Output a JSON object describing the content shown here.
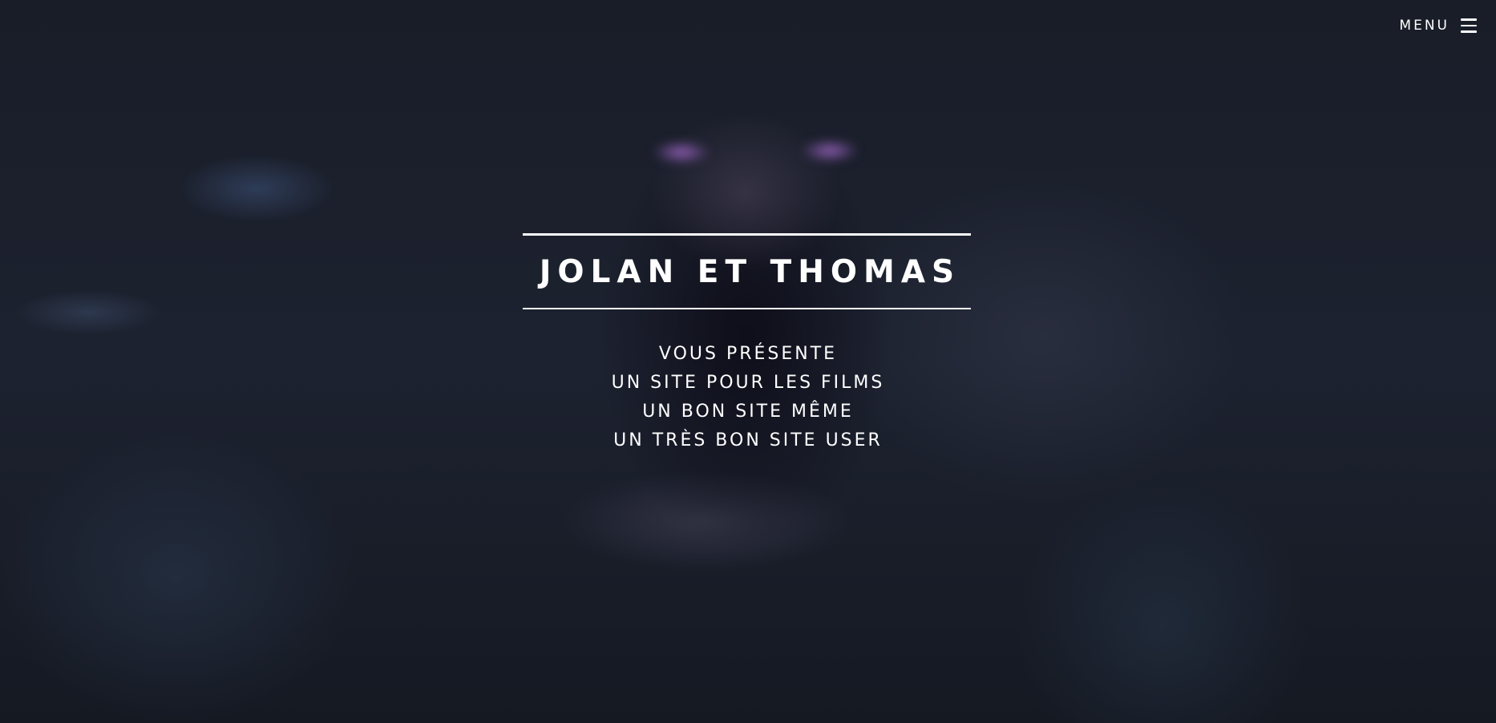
{
  "nav": {
    "menu_label": "MENU",
    "menu_icon": "hamburger-icon"
  },
  "hero": {
    "title": "JOLAN ET THOMAS",
    "tagline_lines": [
      "VOUS PRÉSENTE",
      "UN SITE POUR LES FILMS",
      "UN BON SITE MÊME",
      "UN TRÈS BON SITE USER"
    ]
  },
  "colors": {
    "text": "#ffffff",
    "background": "#1a1f2b",
    "accent_glow": "#a46ed2"
  }
}
